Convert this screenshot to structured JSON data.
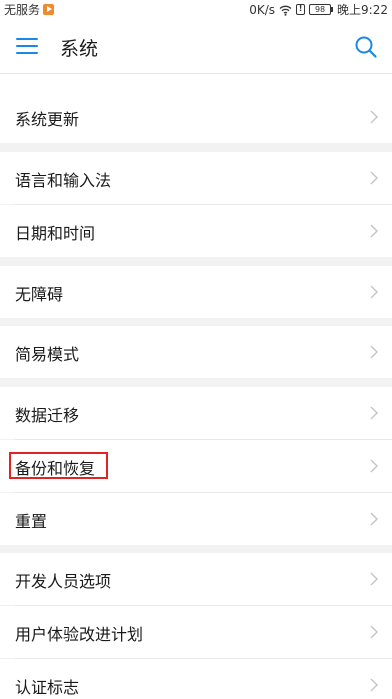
{
  "status_bar": {
    "carrier": "无服务",
    "speed": "0K/s",
    "battery": "98",
    "time": "晚上9:22"
  },
  "app_bar": {
    "title": "系统"
  },
  "items": [
    {
      "label": "系统更新"
    },
    {
      "label": "语言和输入法"
    },
    {
      "label": "日期和时间"
    },
    {
      "label": "无障碍"
    },
    {
      "label": "简易模式"
    },
    {
      "label": "数据迁移"
    },
    {
      "label": "备份和恢复"
    },
    {
      "label": "重置"
    },
    {
      "label": "开发人员选项"
    },
    {
      "label": "用户体验改进计划"
    },
    {
      "label": "认证标志"
    }
  ],
  "colors": {
    "accent": "#1a88e6",
    "highlight": "#e02424"
  }
}
